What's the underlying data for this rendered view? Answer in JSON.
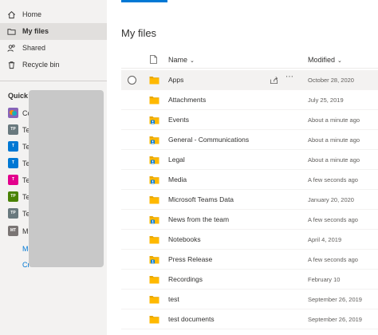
{
  "sidebar": {
    "nav": [
      {
        "label": "Home",
        "icon": "home-icon",
        "active": false
      },
      {
        "label": "My files",
        "icon": "folder-icon",
        "active": true
      },
      {
        "label": "Shared",
        "icon": "shared-people-icon",
        "active": false
      },
      {
        "label": "Recycle bin",
        "icon": "trash-icon",
        "active": false
      }
    ],
    "quick_access": {
      "title": "Quick a",
      "items": [
        {
          "label": "Co",
          "badge": "",
          "color": "#8764b8"
        },
        {
          "label": "Te",
          "badge": "TP",
          "color": "#69797e"
        },
        {
          "label": "Te",
          "badge": "T",
          "color": "#0078d4"
        },
        {
          "label": "Te",
          "badge": "T",
          "color": "#0078d4"
        },
        {
          "label": "Te",
          "badge": "T",
          "color": "#e3008c"
        },
        {
          "label": "Te",
          "badge": "TP",
          "color": "#498205"
        },
        {
          "label": "Te",
          "badge": "TP",
          "color": "#69797e"
        },
        {
          "label": "M",
          "badge": "MT",
          "color": "#7a7574"
        }
      ],
      "links": [
        "Mo",
        "Cr"
      ]
    }
  },
  "main": {
    "title": "My files",
    "columns": {
      "name": "Name",
      "modified": "Modified",
      "sort_caret": "⌄"
    },
    "files": [
      {
        "name": "Apps",
        "modified": "October 28, 2020",
        "shared": false,
        "selected": true
      },
      {
        "name": "Attachments",
        "modified": "July 25, 2019",
        "shared": false,
        "selected": false
      },
      {
        "name": "Events",
        "modified": "About a minute ago",
        "shared": true,
        "selected": false
      },
      {
        "name": "General - Communications",
        "modified": "About a minute ago",
        "shared": true,
        "selected": false
      },
      {
        "name": "Legal",
        "modified": "About a minute ago",
        "shared": true,
        "selected": false
      },
      {
        "name": "Media",
        "modified": "A few seconds ago",
        "shared": true,
        "selected": false
      },
      {
        "name": "Microsoft Teams Data",
        "modified": "January 20, 2020",
        "shared": false,
        "selected": false
      },
      {
        "name": "News from the team",
        "modified": "A few seconds ago",
        "shared": true,
        "selected": false
      },
      {
        "name": "Notebooks",
        "modified": "April 4, 2019",
        "shared": false,
        "selected": false
      },
      {
        "name": "Press Release",
        "modified": "A few seconds ago",
        "shared": true,
        "selected": false
      },
      {
        "name": "Recordings",
        "modified": "February 10",
        "shared": false,
        "selected": false
      },
      {
        "name": "test",
        "modified": "September 26, 2019",
        "shared": false,
        "selected": false
      },
      {
        "name": "test documents",
        "modified": "September 26, 2019",
        "shared": false,
        "selected": false
      }
    ],
    "row_actions": {
      "more": "⋯"
    }
  },
  "colors": {
    "accent": "#0078d4",
    "folder": "#ffb900",
    "folder_tab": "#e8a600"
  }
}
